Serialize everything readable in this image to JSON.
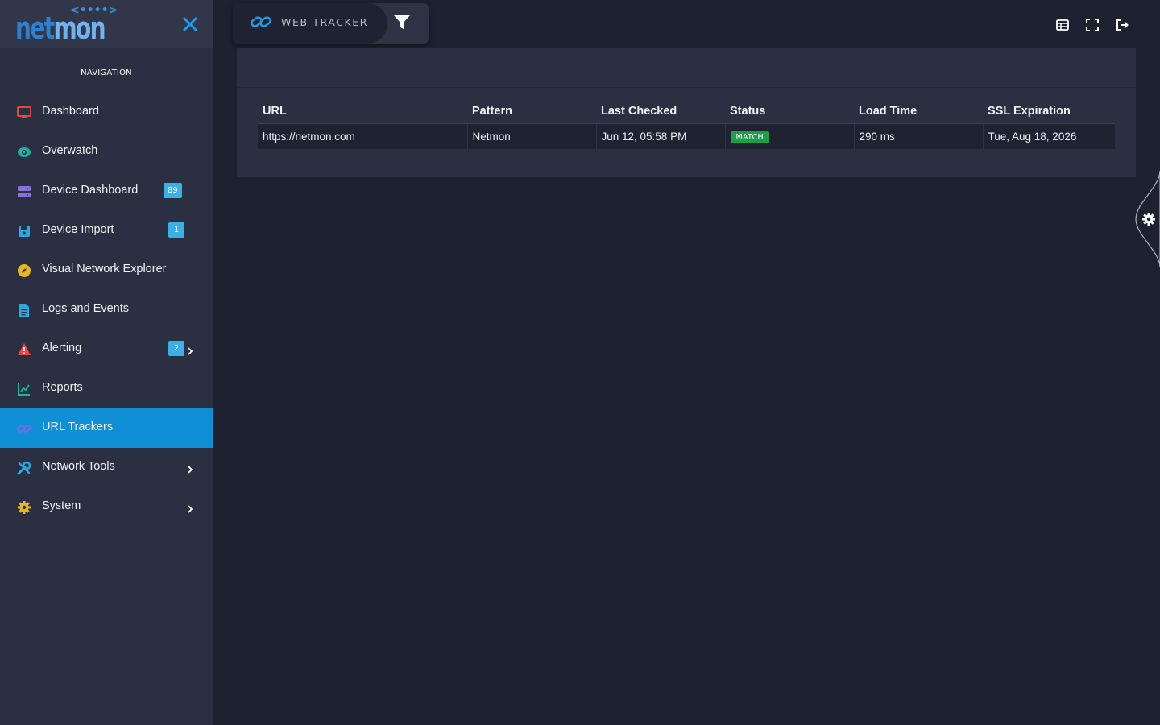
{
  "app": {
    "logo_net": "net",
    "logo_mon": "mon",
    "logo_dots": "<••••>"
  },
  "sidebar": {
    "nav_title": "NAVIGATION",
    "items": [
      {
        "label": "Dashboard",
        "icon": "monitor-icon",
        "icon_color": "#e04848"
      },
      {
        "label": "Overwatch",
        "icon": "eye-icon",
        "icon_color": "#1fb0a0"
      },
      {
        "label": "Device Dashboard",
        "icon": "server-icon",
        "icon_color": "#8a72d8",
        "badge": "89"
      },
      {
        "label": "Device Import",
        "icon": "save-icon",
        "icon_color": "#2aa8e0",
        "badge": "1"
      },
      {
        "label": "Visual Network Explorer",
        "icon": "compass-icon",
        "icon_color": "#e8b820"
      },
      {
        "label": "Logs and Events",
        "icon": "file-icon",
        "icon_color": "#2aa8e0"
      },
      {
        "label": "Alerting",
        "icon": "warning-icon",
        "icon_color": "#e84848",
        "badge": "2",
        "has_submenu": true
      },
      {
        "label": "Reports",
        "icon": "chart-line-icon",
        "icon_color": "#1fb0a0"
      },
      {
        "label": "URL Trackers",
        "icon": "link-icon",
        "icon_color": "#7a6ae0",
        "active": true
      },
      {
        "label": "Network Tools",
        "icon": "tools-icon",
        "icon_color": "#2aa8e0",
        "has_submenu": true
      },
      {
        "label": "System",
        "icon": "gear-icon",
        "icon_color": "#e8b820",
        "has_submenu": true
      }
    ]
  },
  "topbar": {
    "title": "WEB TRACKER"
  },
  "table": {
    "headers": [
      "URL",
      "Pattern",
      "Last Checked",
      "Status",
      "Load Time",
      "SSL Expiration"
    ],
    "rows": [
      {
        "url": "https://netmon.com",
        "pattern": "Netmon",
        "last_checked": "Jun 12, 05:58 PM",
        "status": "MATCH",
        "load_time": "290 ms",
        "ssl_expiration": "Tue, Aug 18, 2026"
      }
    ]
  },
  "colors": {
    "accent": "#0f8fd6",
    "status_match": "#1e9e46",
    "badge": "#3ab0e6"
  }
}
